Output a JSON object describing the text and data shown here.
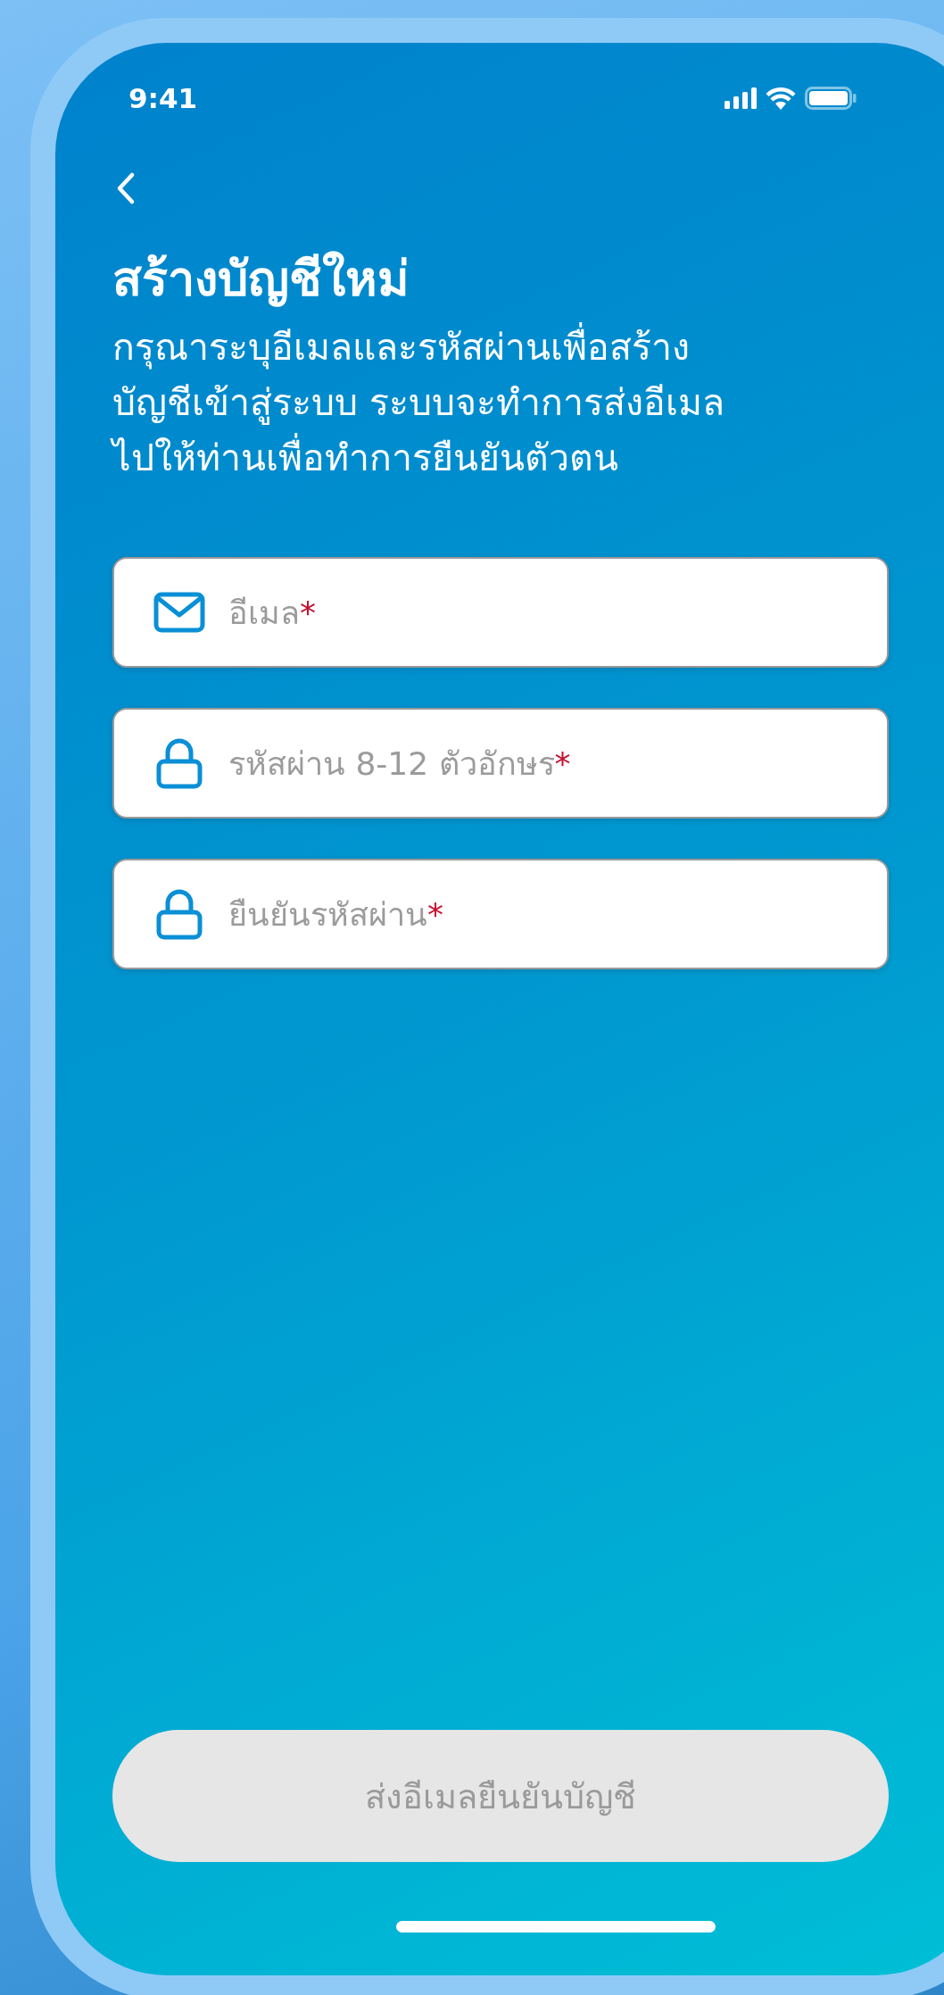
{
  "status_bar": {
    "time": "9:41"
  },
  "header": {
    "title": "สร้างบัญชีใหม่",
    "subtitle": "กรุณาระบุอีเมลและรหัสผ่านเพื่อสร้าง\nบัญชีเข้าสู่ระบบ ระบบจะทำการส่งอีเมล\nไปให้ท่านเพื่อทำการยืนยันตัวตน"
  },
  "fields": [
    {
      "kind": "email",
      "placeholder": "อีเมล",
      "required_mark": "*"
    },
    {
      "kind": "password",
      "placeholder": "รหัสผ่าน 8-12 ตัวอักษร",
      "required_mark": "*"
    },
    {
      "kind": "password",
      "placeholder": "ยืนยันรหัสผ่าน",
      "required_mark": "*"
    }
  ],
  "submit_button": {
    "label": "ส่งอีเมลยืนยันบัญชี",
    "disabled": true
  }
}
